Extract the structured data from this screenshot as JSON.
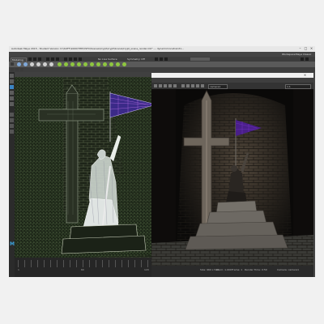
{
  "window": {
    "title": "Autodesk Maya 2015 - Student Version: D:\\SOFT\\1000\\THE\\VSFX\\Scenes\\Crypt\\crypt\\Scene\\Crypt_scene_render.mb* --- dynamicConstraint1..."
  },
  "menubar": [
    "File",
    "Edit",
    "Create",
    "Select",
    "Modify",
    "Display",
    "Windows",
    "Assets",
    "Mesh",
    "Edit Mesh",
    "Mesh Tools",
    "Normals",
    "Color",
    "Create UVs",
    "Edit UVs",
    "Help"
  ],
  "workspace": {
    "label": "Workspace:",
    "value": "Maya Classic"
  },
  "status": {
    "mode_value": "Modeling",
    "live_label": "No Live Surface",
    "symmetry_label": "Symmetry: Off"
  },
  "shelf_tabs": [
    "Curves / Surfaces",
    "Polygons",
    "Sculpting",
    "Rigging",
    "Animation",
    "Rendering",
    "FX",
    "FX Caching",
    "Custom",
    "Arnold",
    "Bifrost",
    "MASH",
    "Motion Graphics",
    "XGen"
  ],
  "viewport": {
    "menu": [
      "View",
      "Shading",
      "Lighting",
      "Show",
      "Renderer",
      "Panels"
    ],
    "timeline_start": "1",
    "timeline_mid": "60",
    "timeline_end": "120"
  },
  "render_view": {
    "title": "Render View",
    "menu": [
      "File",
      "View",
      "Render",
      "IPR",
      "Options",
      "Display",
      "Show",
      "Render Target",
      "Help"
    ],
    "camera": "camera1",
    "zoom": "1:1",
    "status": {
      "size": "Size: 960 x 540",
      "zoom": "zoom: 1.000",
      "frame": "Frame: 1",
      "render_time": "Render Time: 0:59",
      "camera": "Camera: camera1"
    }
  },
  "colors": {
    "maya_blue": "#3b84c4",
    "shelf_green": "#8ec63f",
    "banner": "#6b2fb5"
  }
}
